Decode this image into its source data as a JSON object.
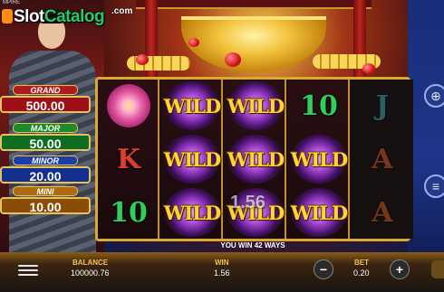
{
  "game": {
    "title_small": "MPIRE",
    "watermark": {
      "brand_part1": "Slot",
      "brand_part2": "Catalog",
      "suffix": ".com"
    }
  },
  "jackpots": [
    {
      "label": "GRAND",
      "value": "500.00"
    },
    {
      "label": "MAJOR",
      "value": "50.00"
    },
    {
      "label": "MINOR",
      "value": "20.00"
    },
    {
      "label": "MINI",
      "value": "10.00"
    }
  ],
  "reels": [
    [
      "flower",
      "K",
      "10"
    ],
    [
      "WILD",
      "WILD",
      "WILD"
    ],
    [
      "WILD",
      "WILD",
      "WILD"
    ],
    [
      "10",
      "WILD",
      "WILD"
    ],
    [
      "J",
      "A",
      "A"
    ]
  ],
  "win_overlay": "1.56",
  "win_message": "YOU WIN 42 WAYS",
  "bottom_bar": {
    "balance_label": "BALANCE",
    "balance_value": "100000.76",
    "win_label": "WIN",
    "win_value": "1.56",
    "bet_label": "BET",
    "bet_value": "0.20",
    "minus_symbol": "−",
    "plus_symbol": "+"
  },
  "icons": {
    "menu": "menu-icon",
    "zoom": "magnifier-plus-icon",
    "coins": "coin-stack-icon"
  },
  "colors": {
    "grand": "#b3181b",
    "major": "#1a8a2b",
    "minor": "#1d3ea8",
    "mini": "#b26a10",
    "frame_gold": "#d9a933",
    "wild_text": "#ffd43a",
    "bar_label": "#f3c14b"
  }
}
